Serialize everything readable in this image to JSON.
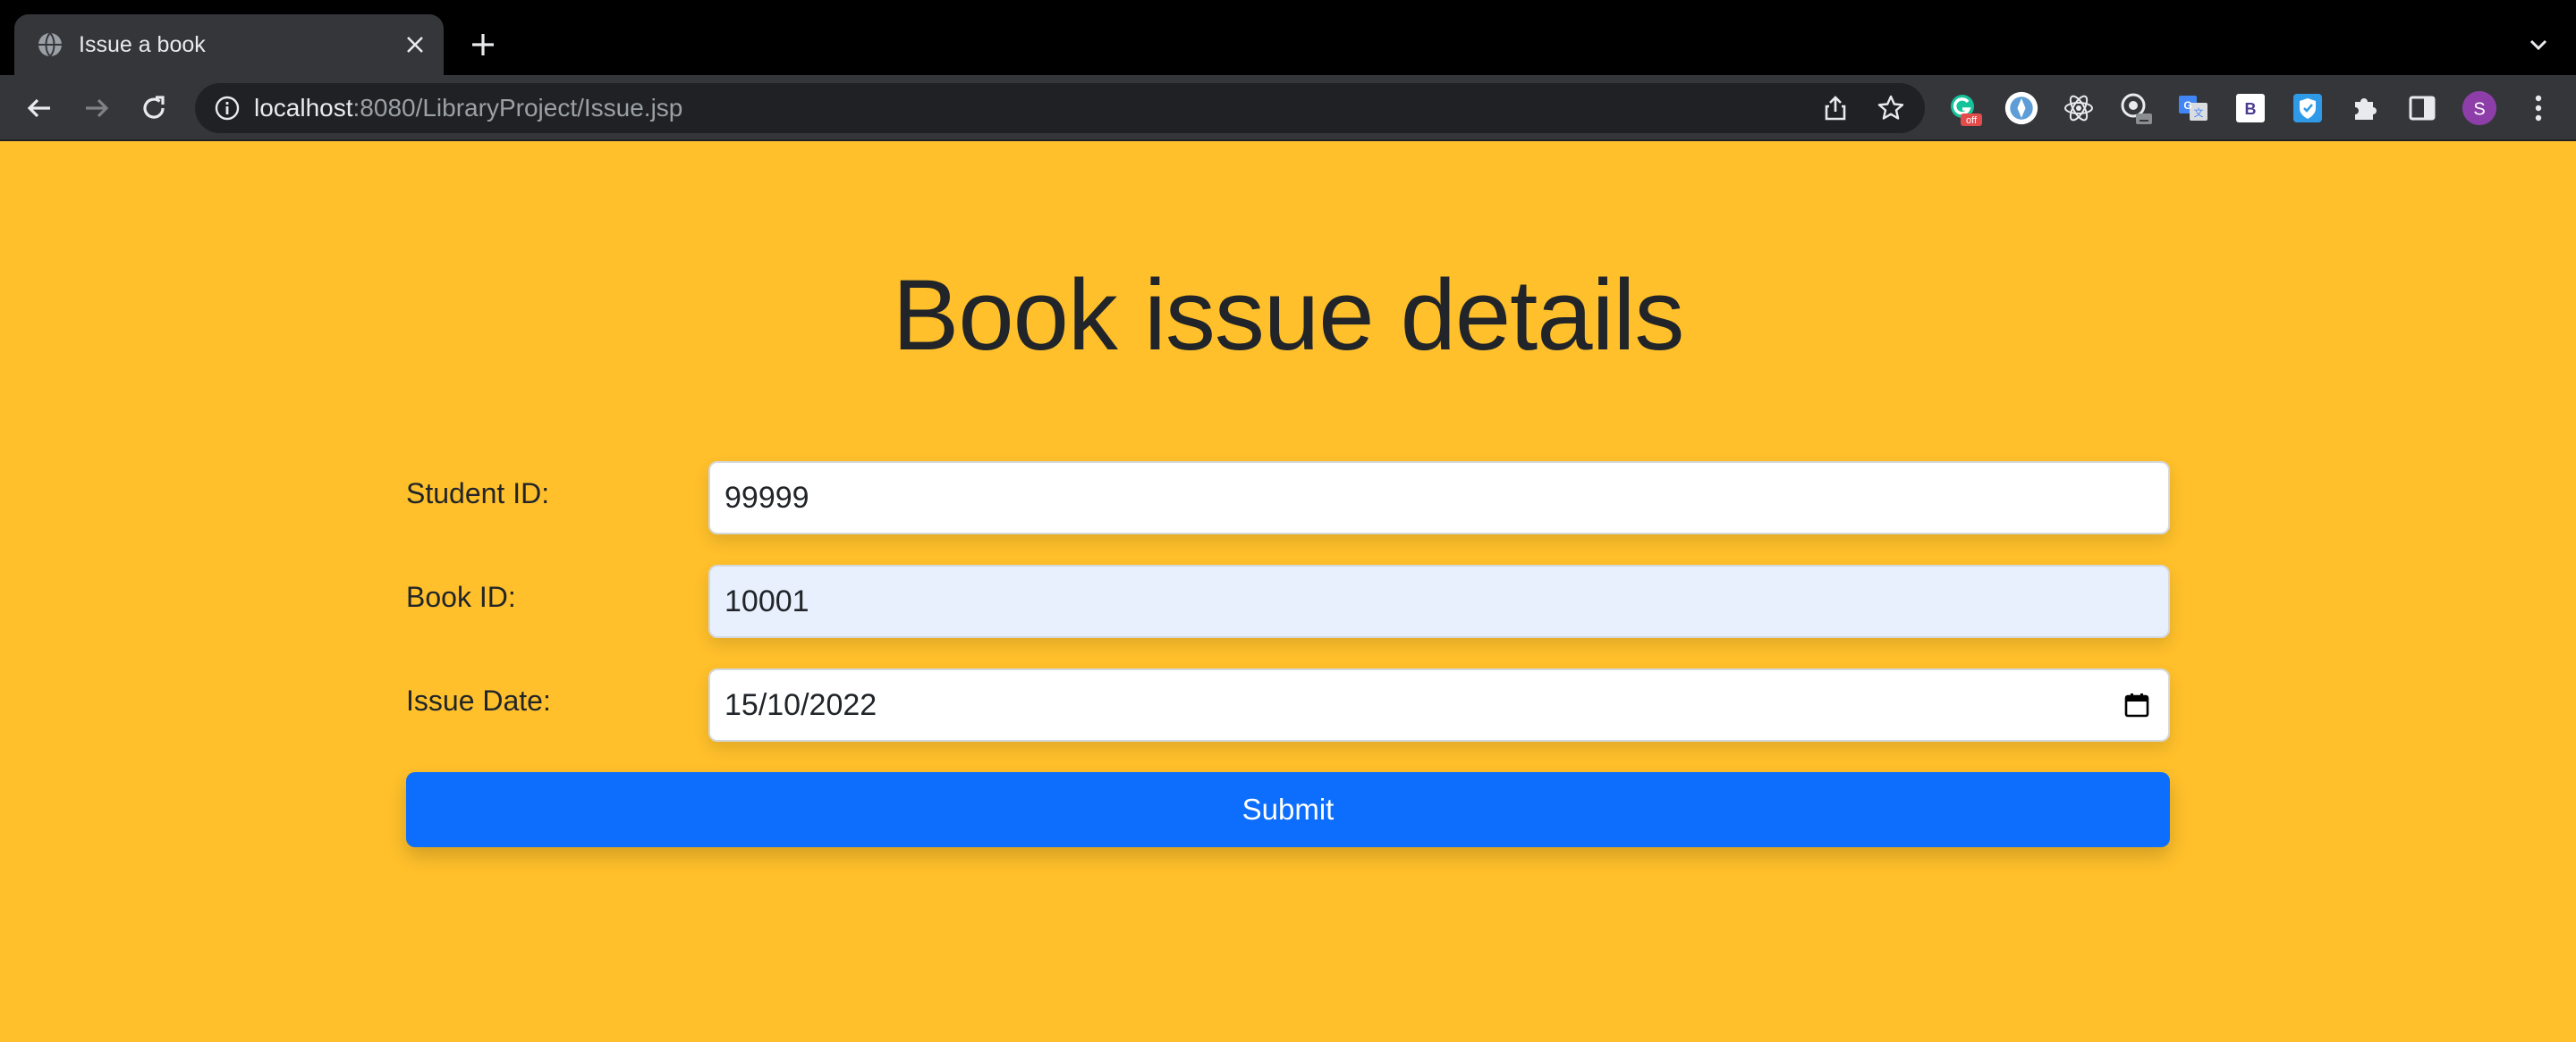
{
  "browser": {
    "tab": {
      "title": "Issue a book",
      "icon": "globe-icon"
    },
    "address": {
      "host": "localhost",
      "path": ":8080/LibraryProject/Issue.jsp"
    },
    "profile_initial": "S",
    "extension_badge": "off",
    "extensions": [
      "grammarly-icon",
      "compass-icon",
      "react-icon",
      "devtools-icon",
      "translate-icon",
      "bootstrap-icon",
      "shield-icon",
      "puzzle-icon",
      "sidepanel-icon"
    ]
  },
  "page": {
    "heading": "Book issue details",
    "background": "#ffc02b",
    "fields": [
      {
        "label": "Student ID:",
        "value": "99999"
      },
      {
        "label": "Book ID:",
        "value": "10001"
      },
      {
        "label": "Issue Date:",
        "value": "15/10/2022"
      }
    ],
    "submit_label": "Submit",
    "accent": "#0d6efd"
  }
}
